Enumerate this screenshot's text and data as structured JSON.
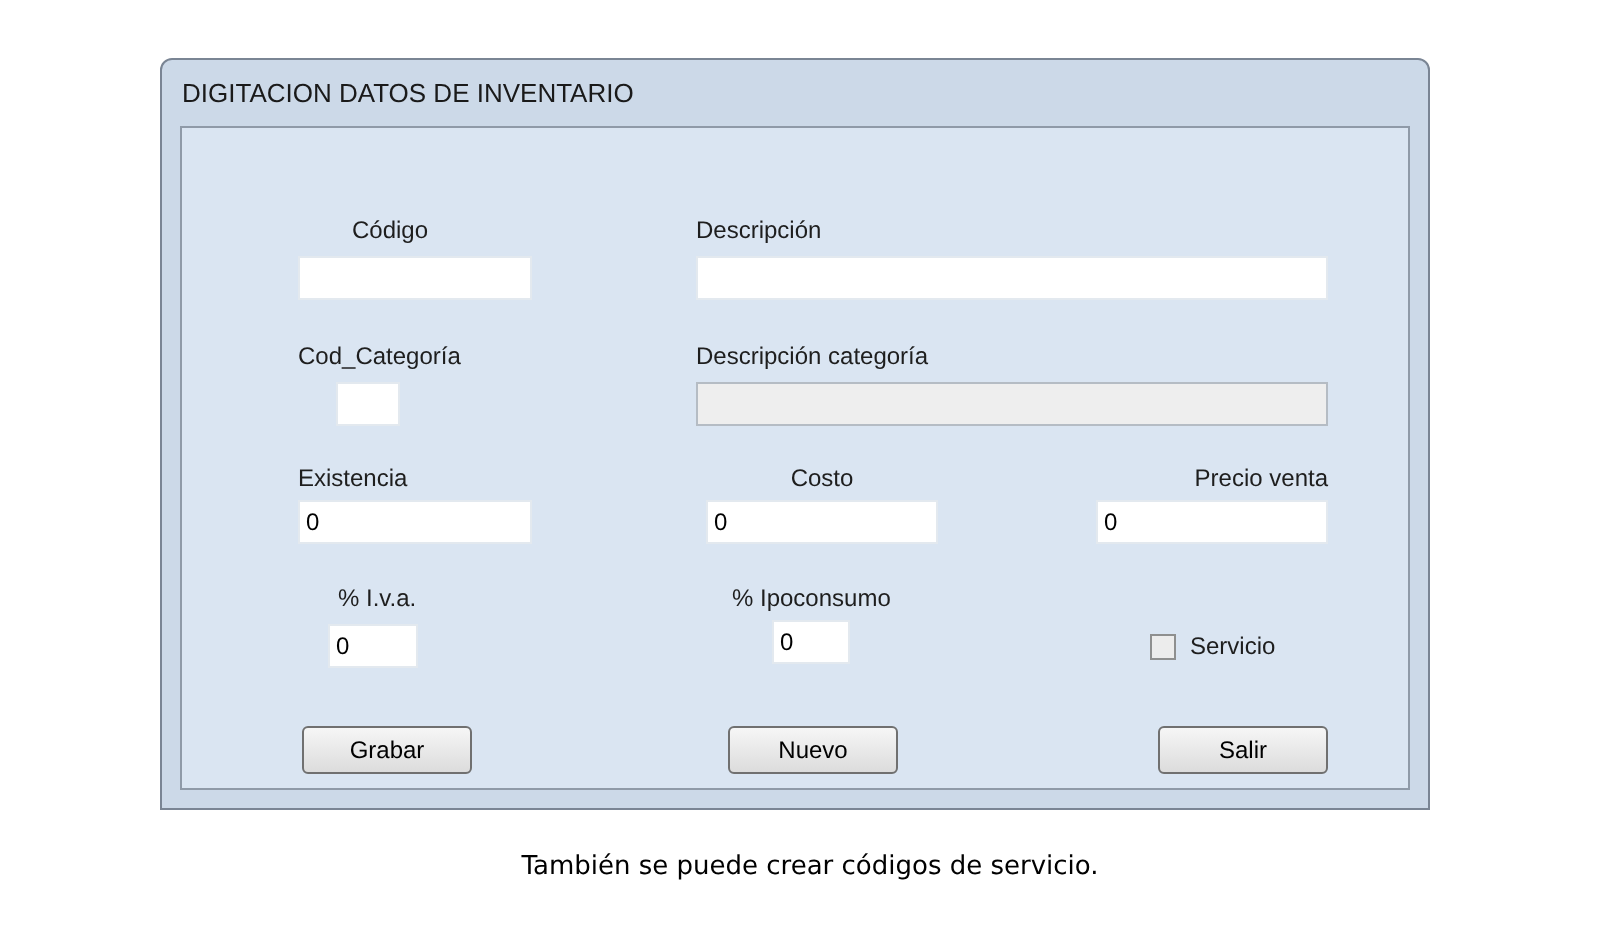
{
  "window": {
    "title": "DIGITACION DATOS DE INVENTARIO"
  },
  "fields": [
    {
      "label": "Código",
      "disabled": false
    },
    {
      "label": "Descripción",
      "disabled": false
    },
    {
      "label": "Cod_Categoría",
      "disabled": false
    },
    {
      "label": "Descripción categoría",
      "disabled": true
    },
    {
      "label": "Existencia",
      "value": "0",
      "disabled": false
    },
    {
      "label": "Costo",
      "value": "0",
      "disabled": false
    },
    {
      "label": "Precio venta",
      "value": "0",
      "disabled": false
    },
    {
      "label": "% I.v.a.",
      "value": "0",
      "disabled": false
    },
    {
      "label": "% Ipoconsumo",
      "value": "0",
      "disabled": false
    }
  ],
  "checkbox": {
    "label": "Servicio",
    "checked": false
  },
  "buttons": [
    "Grabar",
    "Nuevo",
    "Salir"
  ],
  "caption": "También se puede crear códigos de servicio."
}
